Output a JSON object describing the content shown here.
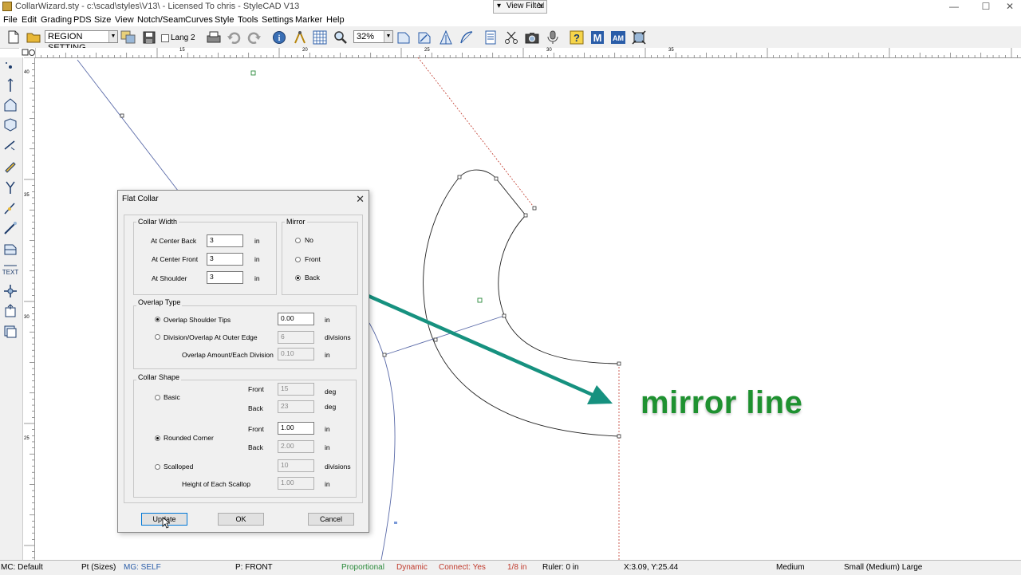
{
  "window": {
    "title": "CollarWizard.sty - c:\\scad\\styles\\V13\\ - Licensed To chris - StyleCAD V13",
    "view_filter": "View Filter",
    "minimize": "—",
    "maximize": "☐",
    "close": "✕"
  },
  "menu": [
    "File",
    "Edit",
    "Grading",
    "PDS",
    "Size",
    "View",
    "Notch/Seam",
    "Curves",
    "Style",
    "Tools",
    "Settings",
    "Marker",
    "Help"
  ],
  "toolbar": {
    "region_setting": "REGION SETTING",
    "lang2": "Lang 2",
    "zoom": "32%"
  },
  "ruler": {
    "top_ticks": [
      "15",
      "20",
      "25",
      "30",
      "35"
    ],
    "left_ticks": [
      "40",
      "35",
      "30",
      "25"
    ]
  },
  "dialog": {
    "title": "Flat Collar",
    "collar_width": {
      "label": "Collar Width",
      "center_back_label": "At Center Back",
      "center_back": "3",
      "center_front_label": "At Center Front",
      "center_front": "3",
      "shoulder_label": "At Shoulder",
      "shoulder": "3",
      "unit": "in"
    },
    "mirror": {
      "label": "Mirror",
      "options": [
        "No",
        "Front",
        "Back"
      ],
      "selected": "Back"
    },
    "overlap": {
      "label": "Overlap Type",
      "shoulder_tips_label": "Overlap Shoulder Tips",
      "shoulder_tips": "0.00",
      "shoulder_tips_unit": "in",
      "division_label": "Division/Overlap At Outer Edge",
      "division": "6",
      "division_unit": "divisions",
      "amount_label": "Overlap Amount/Each Division",
      "amount": "0.10",
      "amount_unit": "in"
    },
    "shape": {
      "label": "Collar Shape",
      "basic_label": "Basic",
      "basic_front_label": "Front",
      "basic_front": "15",
      "basic_back_label": "Back",
      "basic_back": "23",
      "deg": "deg",
      "rounded_label": "Rounded Corner",
      "rounded_front_label": "Front",
      "rounded_front": "1.00",
      "rounded_back_label": "Back",
      "rounded_back": "2.00",
      "in": "in",
      "scalloped_label": "Scalloped",
      "scalloped": "10",
      "scalloped_unit": "divisions",
      "scallop_height_label": "Height of Each Scallop",
      "scallop_height": "1.00"
    },
    "buttons": {
      "update": "Update",
      "ok": "OK",
      "cancel": "Cancel"
    }
  },
  "annotation": "mirror line",
  "annotation_color": "#1e9130",
  "arrow_color": "#16917f",
  "status": {
    "mc": "MC: Default",
    "pt": "Pt (Sizes)",
    "mg": "MG: SELF",
    "p": "P: FRONT",
    "proportional": "Proportional",
    "dynamic": "Dynamic",
    "connect": "Connect: Yes",
    "eighth": "1/8 in",
    "ruler": "Ruler: 0 in",
    "coords": "X:3.09, Y:25.44",
    "medium": "Medium",
    "size": "Small (Medium) Large"
  }
}
